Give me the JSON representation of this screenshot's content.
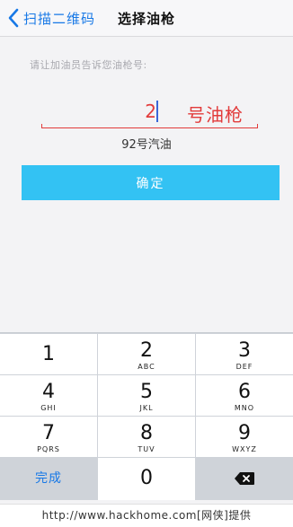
{
  "nav": {
    "back_label": "扫描二维码",
    "title": "选择油枪"
  },
  "form": {
    "instruction": "请让加油员告诉您油枪号:",
    "pump_value": "2",
    "pump_suffix": "号油枪",
    "fuel_type": "92号汽油",
    "confirm_label": "确定"
  },
  "keypad": {
    "keys": [
      {
        "digit": "1",
        "letters": ""
      },
      {
        "digit": "2",
        "letters": "ABC"
      },
      {
        "digit": "3",
        "letters": "DEF"
      },
      {
        "digit": "4",
        "letters": "GHI"
      },
      {
        "digit": "5",
        "letters": "JKL"
      },
      {
        "digit": "6",
        "letters": "MNO"
      },
      {
        "digit": "7",
        "letters": "PQRS"
      },
      {
        "digit": "8",
        "letters": "TUV"
      },
      {
        "digit": "9",
        "letters": "WXYZ"
      }
    ],
    "done_label": "完成",
    "zero": "0"
  },
  "footer": {
    "text": "http://www.hackhome.com[网侠]提供"
  },
  "colors": {
    "accent_blue": "#1778e6",
    "button_cyan": "#33c2f3",
    "input_red": "#e23b3b",
    "caret_blue": "#3a67d9"
  }
}
